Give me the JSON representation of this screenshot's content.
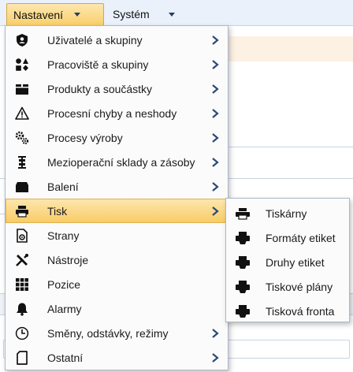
{
  "menubar": {
    "items": [
      {
        "label": "Nastavení",
        "icon": "chevron-down-icon"
      },
      {
        "label": "Systém",
        "icon": "chevron-down-icon"
      }
    ]
  },
  "menu": {
    "items": [
      {
        "label": "Uživatelé a skupiny",
        "icon": "shield-icon",
        "has_submenu": true
      },
      {
        "label": "Pracoviště a skupiny",
        "icon": "shapes-icon",
        "has_submenu": true
      },
      {
        "label": "Produkty a součástky",
        "icon": "box-icon",
        "has_submenu": true
      },
      {
        "label": "Procesní chyby a neshody",
        "icon": "warning-icon",
        "has_submenu": true
      },
      {
        "label": "Procesy výroby",
        "icon": "gears-icon",
        "has_submenu": true
      },
      {
        "label": "Mezioperační sklady a zásoby",
        "icon": "warehouse-icon",
        "has_submenu": true
      },
      {
        "label": "Balení",
        "icon": "package-icon",
        "has_submenu": true
      },
      {
        "label": "Tisk",
        "icon": "printer-icon",
        "has_submenu": true,
        "highlighted": true
      },
      {
        "label": "Strany",
        "icon": "document-icon",
        "has_submenu": false
      },
      {
        "label": "Nástroje",
        "icon": "tools-icon",
        "has_submenu": false
      },
      {
        "label": "Pozice",
        "icon": "grid-icon",
        "has_submenu": false
      },
      {
        "label": "Alarmy",
        "icon": "bell-icon",
        "has_submenu": false
      },
      {
        "label": "Směny, odstávky, režimy",
        "icon": "clock-icon",
        "has_submenu": true
      },
      {
        "label": "Ostatní",
        "icon": "file-icon",
        "has_submenu": true
      }
    ]
  },
  "submenu": {
    "items": [
      {
        "label": "Tiskárny",
        "icon": "printer-icon"
      },
      {
        "label": "Formáty etiket",
        "icon": "label-printer-icon"
      },
      {
        "label": "Druhy etiket",
        "icon": "label-printer-icon"
      },
      {
        "label": "Tiskové plány",
        "icon": "label-printer-icon"
      },
      {
        "label": "Tisková fronta",
        "icon": "label-printer-icon"
      }
    ]
  },
  "colors": {
    "highlight": "#f8cc66",
    "menubar_bg": "#eaf1fb",
    "arrow": "#2b4a7a"
  }
}
